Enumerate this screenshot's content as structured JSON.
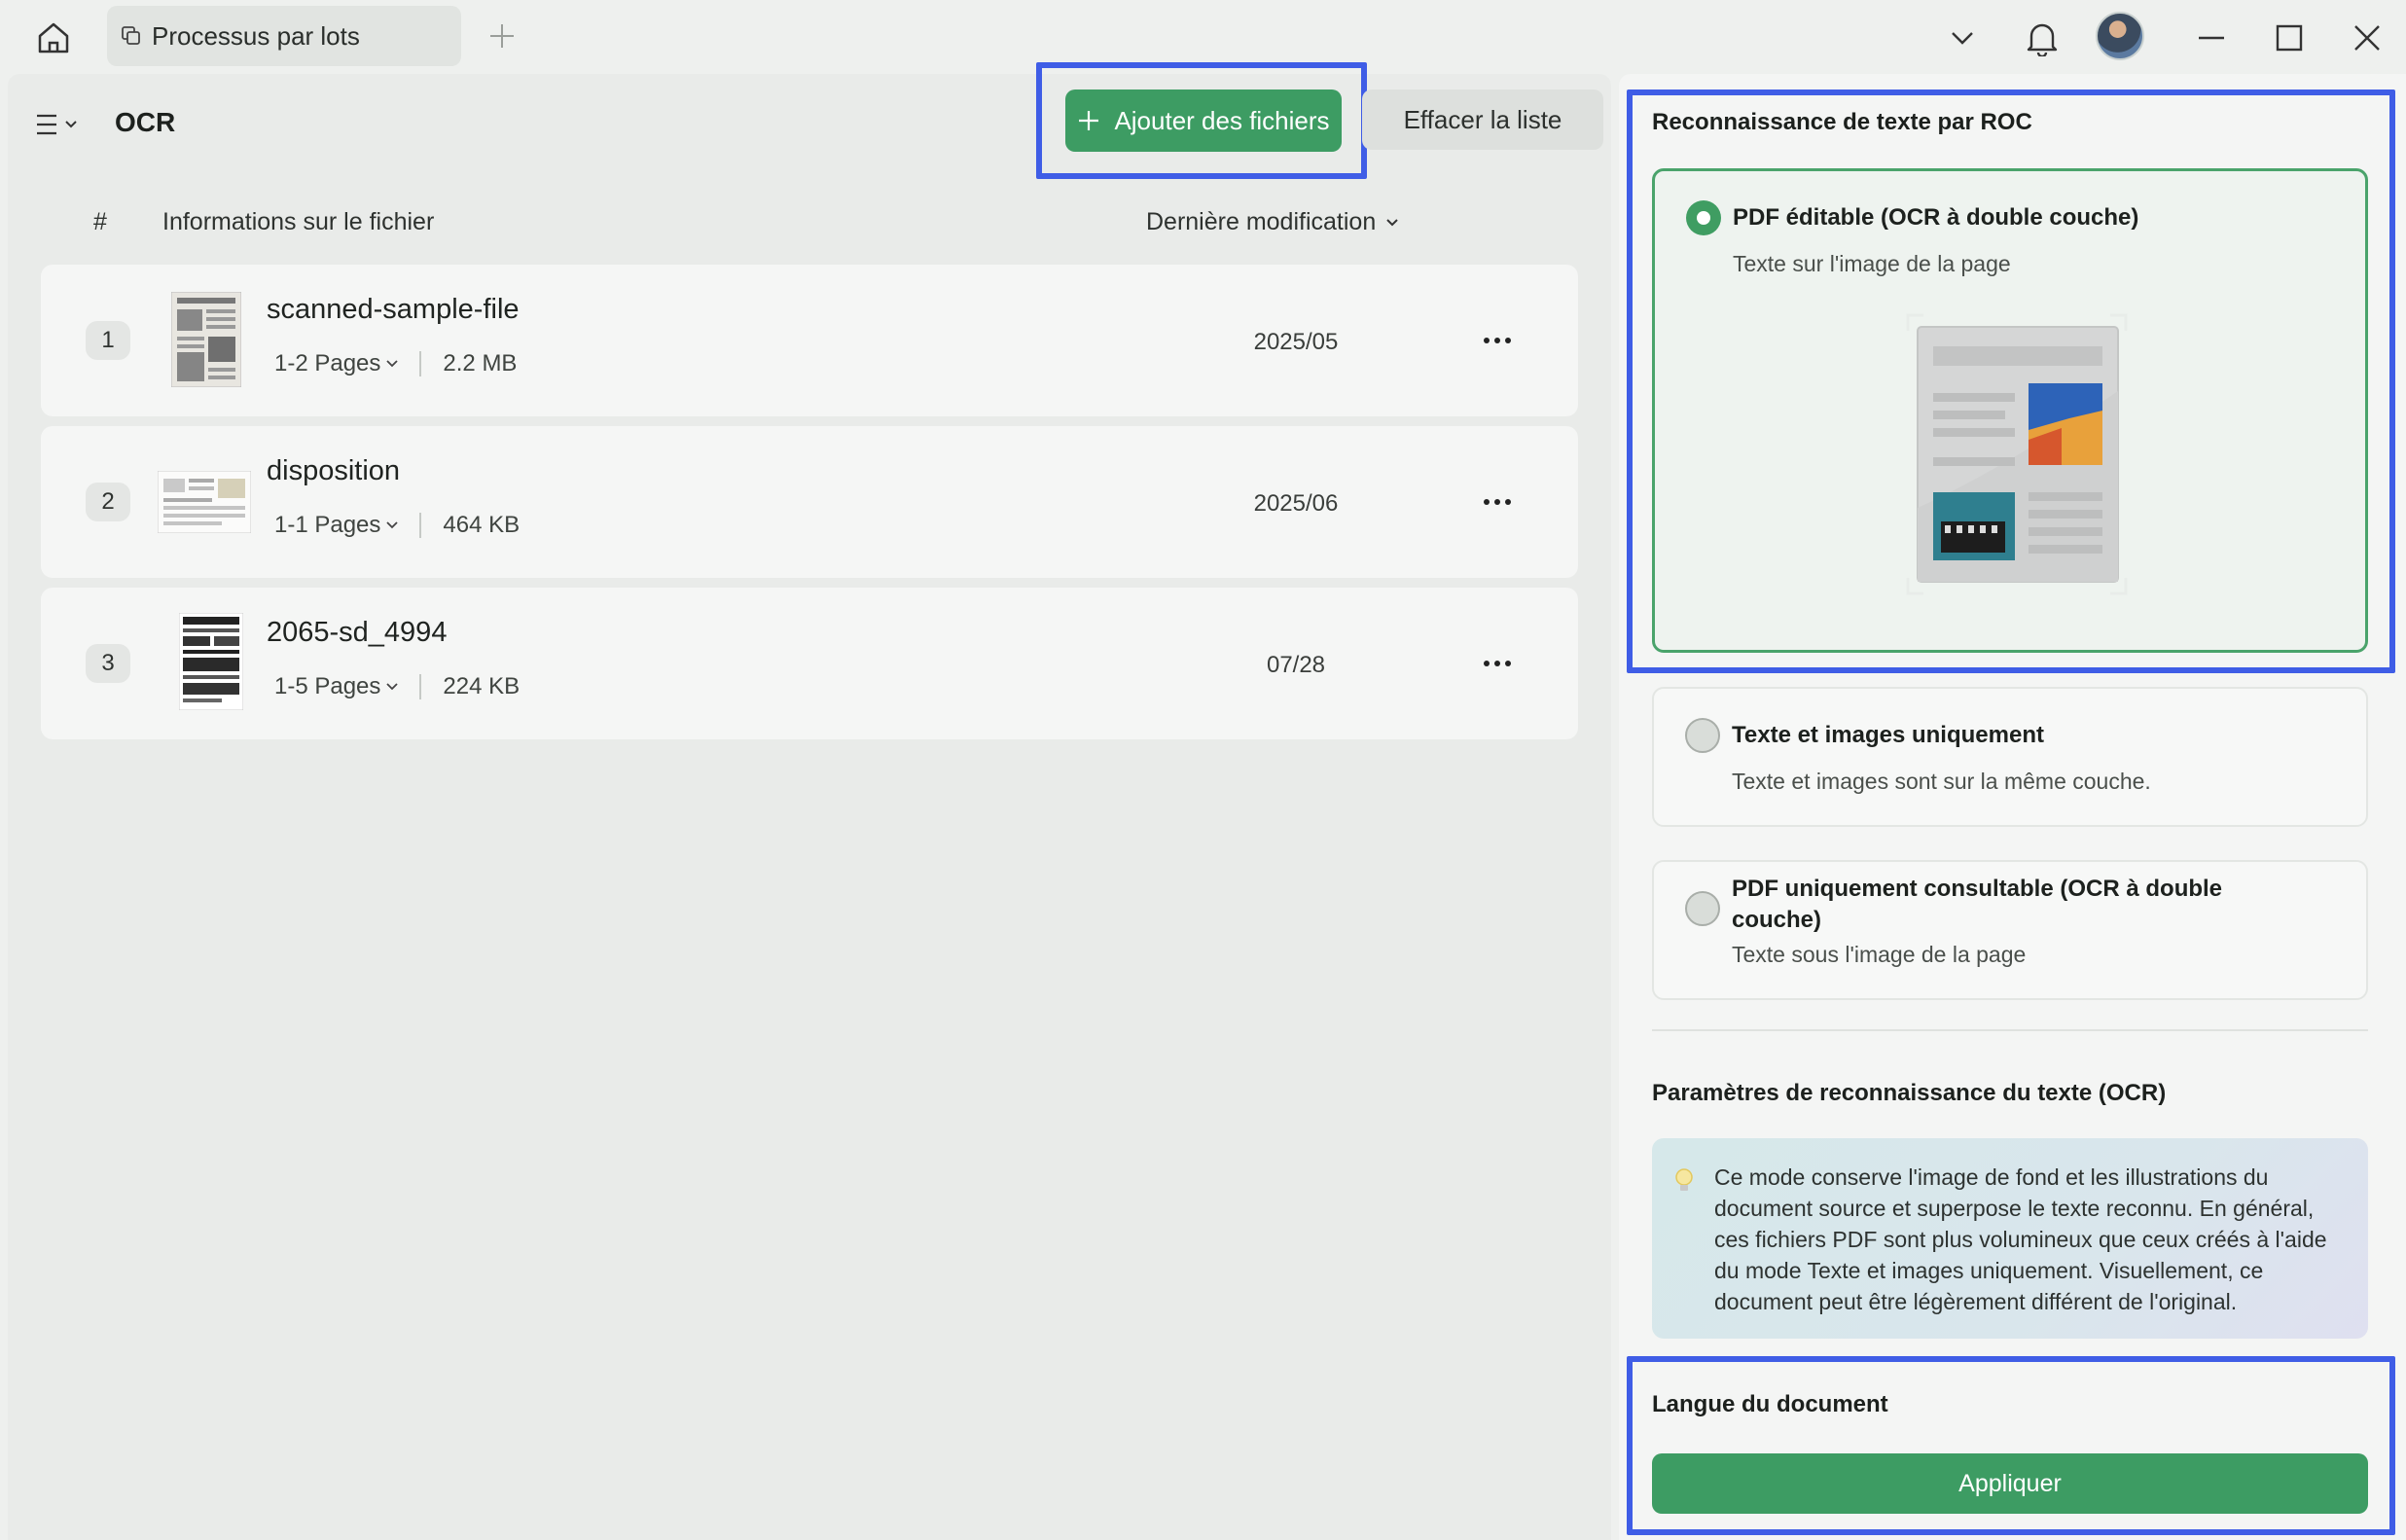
{
  "titlebar": {
    "tab_label": "Processus par lots",
    "icons": {
      "home": "home-icon",
      "tab": "batch-copy-icon",
      "new_tab": "plus-icon",
      "dropdown": "chevron-down-icon",
      "notifications": "bell-icon",
      "minimize": "minimize-icon",
      "maximize": "maximize-icon",
      "close": "close-icon"
    }
  },
  "toolbar": {
    "title": "OCR",
    "add_files_label": "Ajouter des fichiers",
    "clear_list_label": "Effacer la liste"
  },
  "file_table": {
    "columns": {
      "index": "#",
      "info": "Informations sur le fichier",
      "modified": "Dernière modification"
    },
    "rows": [
      {
        "index": "1",
        "name": "scanned-sample-file",
        "pages": "1-2 Pages",
        "size": "2.2 MB",
        "date": "2025/05"
      },
      {
        "index": "2",
        "name": "disposition",
        "pages": "1-1 Pages",
        "size": "464 KB",
        "date": "2025/06"
      },
      {
        "index": "3",
        "name": "2065-sd_4994",
        "pages": "1-5 Pages",
        "size": "224 KB",
        "date": "07/28"
      }
    ]
  },
  "ocr_panel": {
    "section_title": "Reconnaissance de texte par ROC",
    "options": [
      {
        "title": "PDF éditable (OCR à double couche)",
        "desc": "Texte sur l'image de la page",
        "selected": true
      },
      {
        "title": "Texte et images uniquement",
        "desc": "Texte et images sont sur la même couche.",
        "selected": false
      },
      {
        "title_line1": "PDF uniquement consultable (OCR à double",
        "title_line2": "couche)",
        "desc": "Texte sous l'image de la page",
        "selected": false
      }
    ],
    "settings_title": "Paramètres de reconnaissance du texte (OCR)",
    "info_text": "Ce mode conserve l'image de fond et les illustrations du document source et superpose le texte reconnu. En général, ces fichiers PDF sont plus volumineux que ceux créés à l'aide du mode Texte et images uniquement. Visuellement, ce document peut être légèrement différent de l'original.",
    "language_title": "Langue du document",
    "apply_label": "Appliquer"
  },
  "colors": {
    "accent": "#3d9c63",
    "highlight": "#3f5de6"
  }
}
